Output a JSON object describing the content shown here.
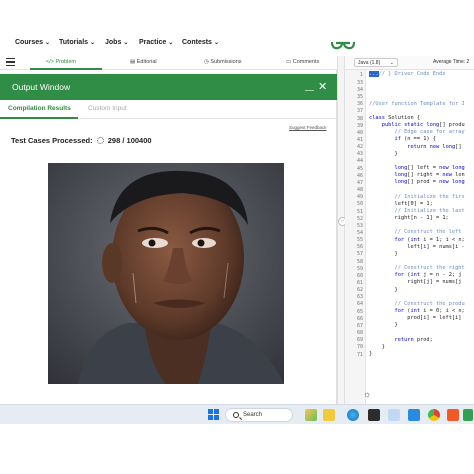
{
  "nav": {
    "items": [
      {
        "label": "Courses"
      },
      {
        "label": "Tutorials"
      },
      {
        "label": "Jobs"
      },
      {
        "label": "Practice"
      },
      {
        "label": "Contests"
      }
    ],
    "chevron": "⌄"
  },
  "problem_tabs": [
    {
      "label": "</> Problem",
      "icon": "code-icon"
    },
    {
      "label": "Editorial",
      "icon": "document-icon"
    },
    {
      "label": "Submissions",
      "icon": "clock-icon"
    },
    {
      "label": "Comments",
      "icon": "comment-icon"
    }
  ],
  "output_window": {
    "title": "Output Window",
    "minimize": "__",
    "close": "✕",
    "tabs": {
      "compilation": "Compilation Results",
      "custom": "Custom Input"
    },
    "suggest_feedback": "Suggest Feedback",
    "test_cases_label": "Test Cases Processed:",
    "test_cases_value": "298 / 100400"
  },
  "editor": {
    "language": "Java (1.8)",
    "average_time": "Average Time: 2",
    "lines": [
      {
        "n": "33",
        "code": ""
      },
      {
        "n": "34",
        "code": ""
      },
      {
        "n": "35",
        "code": ""
      },
      {
        "n": "36",
        "code": "//User function Template for J"
      },
      {
        "n": "37",
        "code": ""
      },
      {
        "n": "38",
        "code": "class Solution {"
      },
      {
        "n": "39",
        "code": "    public static long[] produ"
      },
      {
        "n": "40",
        "code": "        // Edge case for array"
      },
      {
        "n": "41",
        "code": "        if (n == 1) {"
      },
      {
        "n": "42",
        "code": "            return new long[]"
      },
      {
        "n": "43",
        "code": "        }"
      },
      {
        "n": "44",
        "code": ""
      },
      {
        "n": "45",
        "code": "        long[] left = new long"
      },
      {
        "n": "46",
        "code": "        long[] right = new lon"
      },
      {
        "n": "47",
        "code": "        long[] prod = new long"
      },
      {
        "n": "48",
        "code": ""
      },
      {
        "n": "49",
        "code": "        // Initialize the firs"
      },
      {
        "n": "50",
        "code": "        left[0] = 1;"
      },
      {
        "n": "51",
        "code": "        // Initialize the last"
      },
      {
        "n": "52",
        "code": "        right[n - 1] = 1;"
      },
      {
        "n": "53",
        "code": ""
      },
      {
        "n": "54",
        "code": "        // Construct the left"
      },
      {
        "n": "55",
        "code": "        for (int i = 1; i < n;"
      },
      {
        "n": "56",
        "code": "            left[i] = nums[i -"
      },
      {
        "n": "57",
        "code": "        }"
      },
      {
        "n": "58",
        "code": ""
      },
      {
        "n": "59",
        "code": "        // Construct the right"
      },
      {
        "n": "60",
        "code": "        for (int j = n - 2; j"
      },
      {
        "n": "61",
        "code": "            right[j] = nums[j"
      },
      {
        "n": "62",
        "code": "        }"
      },
      {
        "n": "63",
        "code": ""
      },
      {
        "n": "64",
        "code": "        // Construct the produ"
      },
      {
        "n": "65",
        "code": "        for (int i = 0; i < n;"
      },
      {
        "n": "66",
        "code": "            prod[i] = left[i]"
      },
      {
        "n": "67",
        "code": "        }"
      },
      {
        "n": "68",
        "code": ""
      },
      {
        "n": "69",
        "code": "        return prod;"
      },
      {
        "n": "70",
        "code": "    }"
      },
      {
        "n": "71",
        "code": "}"
      }
    ],
    "header_line": {
      "n": "1",
      "code": "// } Driver Code Ends"
    }
  },
  "taskbar": {
    "search_label": "Search"
  },
  "colors": {
    "brand": "#2f8d46"
  }
}
